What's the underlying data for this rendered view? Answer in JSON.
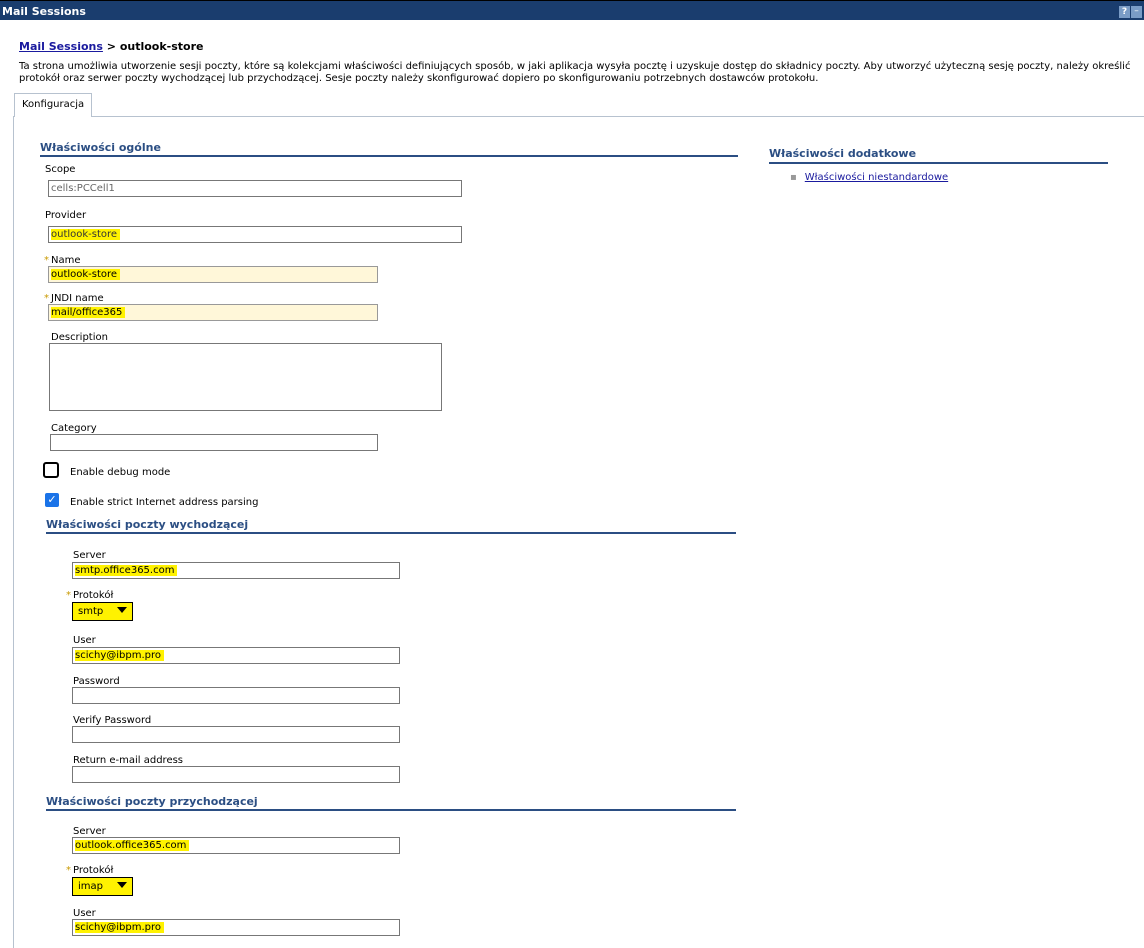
{
  "window": {
    "title": "Mail Sessions",
    "help_label": "?",
    "min_label": "–"
  },
  "breadcrumb": {
    "parent": "Mail Sessions",
    "separator": " > ",
    "current": "outlook-store"
  },
  "intro": "Ta strona umożliwia utworzenie sesji poczty, które są kolekcjami właściwości definiujących sposób, w jaki aplikacja wysyła pocztę i uzyskuje dostęp do składnicy poczty. Aby utworzyć użyteczną sesję poczty, należy określić protokół oraz serwer poczty wychodzącej lub przychodzącej. Sesje poczty należy skonfigurować dopiero po skonfigurowaniu potrzebnych dostawców protokołu.",
  "tabs": [
    {
      "label": "Konfiguracja"
    }
  ],
  "general": {
    "title": "Właściwości ogólne",
    "scope": {
      "label": "Scope",
      "value": "cells:PCCell1"
    },
    "provider": {
      "label": "Provider",
      "value": "outlook-store"
    },
    "name": {
      "label": "Name",
      "value": "outlook-store"
    },
    "jndi": {
      "label": "JNDI name",
      "value": "mail/office365"
    },
    "description": {
      "label": "Description",
      "value": ""
    },
    "category": {
      "label": "Category",
      "value": ""
    },
    "debug": {
      "label": "Enable debug mode",
      "checked": false
    },
    "strict": {
      "label": "Enable strict Internet address parsing",
      "checked": true
    },
    "required_mark": "*"
  },
  "outgoing": {
    "title": "Właściwości poczty wychodzącej",
    "server": {
      "label": "Server",
      "value": "smtp.office365.com"
    },
    "protocol": {
      "label": "Protokół",
      "value": "smtp"
    },
    "user": {
      "label": "User",
      "value": "scichy@ibpm.pro"
    },
    "password": {
      "label": "Password",
      "value": ""
    },
    "verify": {
      "label": "Verify Password",
      "value": ""
    },
    "return_email": {
      "label": "Return e-mail address",
      "value": ""
    }
  },
  "incoming": {
    "title": "Właściwości poczty przychodzącej",
    "server": {
      "label": "Server",
      "value": "outlook.office365.com"
    },
    "protocol": {
      "label": "Protokół",
      "value": "imap"
    },
    "user": {
      "label": "User",
      "value": "scichy@ibpm.pro"
    }
  },
  "additional": {
    "title": "Właściwości dodatkowe",
    "links": [
      {
        "label": "Właściwości niestandardowe"
      }
    ]
  },
  "colors": {
    "titlebar": "#1a3d6e",
    "section": "#2b4e83",
    "highlight": "#fff200",
    "link": "#1a1a9e"
  }
}
